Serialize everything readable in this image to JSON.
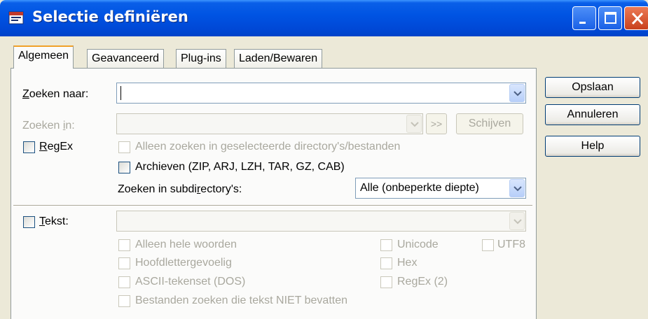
{
  "window": {
    "title": "Selectie definiëren"
  },
  "tabs": [
    {
      "label": "Algemeen"
    },
    {
      "label": "Geavanceerd"
    },
    {
      "label": "Plug-ins"
    },
    {
      "label": "Laden/Bewaren"
    }
  ],
  "buttons": {
    "save": "Opslaan",
    "cancel": "Annuleren",
    "help": "Help",
    "arrow": ">>",
    "drives": "Schijven"
  },
  "search_for": {
    "label_pre": "Z",
    "label_post": "oeken naar:",
    "value": ""
  },
  "search_in": {
    "label_pre": "Zoeken ",
    "label_u": "i",
    "label_post": "n:",
    "value": ""
  },
  "regex": {
    "label_pre": "R",
    "label_post": "egEx"
  },
  "options": {
    "only_selected": "Alleen zoeken in geselecteerde directory's/bestanden",
    "archives": "Archieven (ZIP, ARJ, LZH, TAR, GZ, CAB)"
  },
  "subdirs": {
    "label_pre": "Zoeken in subdi",
    "label_u": "r",
    "label_post": "ectory's:",
    "value": "Alle (onbeperkte diepte)"
  },
  "text_search": {
    "label_pre": "T",
    "label_post": "ekst:",
    "value": "",
    "whole_words": "Alleen hele woorden",
    "case_sensitive": "Hoofdlettergevoelig",
    "ascii": "ASCII-tekenset (DOS)",
    "not_containing": "Bestanden zoeken die tekst NIET bevatten",
    "unicode": "Unicode",
    "utf8": "UTF8",
    "hex": "Hex",
    "regex2": "RegEx (2)"
  },
  "colors": {
    "title_blue": "#0054e3",
    "window_bg": "#ece9d8",
    "close_red": "#c8401c",
    "active_tab_accent": "#f0a028"
  }
}
